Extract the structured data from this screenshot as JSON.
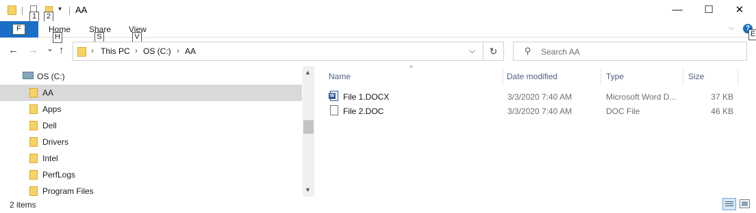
{
  "window": {
    "title": "AA",
    "minimize_glyph": "—",
    "maximize_glyph": "☐",
    "close_glyph": "✕"
  },
  "quick_access": {
    "dropdown_glyph": "▾",
    "keytips": [
      "1",
      "2"
    ]
  },
  "ribbon": {
    "file_keytip": "F",
    "tabs": [
      {
        "label": "Home",
        "keytip": "H"
      },
      {
        "label": "Share",
        "keytip": "S"
      },
      {
        "label": "View",
        "keytip": "V"
      }
    ],
    "expand_glyph": "⌵",
    "help_glyph": "?",
    "help_keytip": "E"
  },
  "nav": {
    "back": "←",
    "forward": "→",
    "recent": "⌄",
    "up": "↑",
    "breadcrumbs": [
      "This PC",
      "OS (C:)",
      "AA"
    ],
    "crumb_sep": "›",
    "address_dropdown": "⌵",
    "refresh": "↻"
  },
  "search": {
    "placeholder": "Search AA",
    "icon_glyph": "⚲"
  },
  "tree": {
    "root": "OS (C:)",
    "items": [
      "AA",
      "Apps",
      "Dell",
      "Drivers",
      "Intel",
      "PerfLogs",
      "Program Files"
    ],
    "selected_index": 0,
    "scroll_up": "▲",
    "scroll_down": "▼"
  },
  "columns": {
    "sort_glyph": "^",
    "name": "Name",
    "date": "Date modified",
    "type": "Type",
    "size": "Size"
  },
  "files": [
    {
      "name": "File 1.DOCX",
      "date": "3/3/2020 7:40 AM",
      "type": "Microsoft Word D...",
      "size": "37 KB",
      "icon": "word-doc-icon"
    },
    {
      "name": "File 2.DOC",
      "date": "3/3/2020 7:40 AM",
      "type": "DOC File",
      "size": "46 KB",
      "icon": "doc-file-icon"
    }
  ],
  "status": {
    "count": "2 items"
  },
  "colors": {
    "accent": "#1a6fc4",
    "folder": "#f6d365",
    "selection": "#d9d9d9",
    "header_text": "#4c607a"
  }
}
